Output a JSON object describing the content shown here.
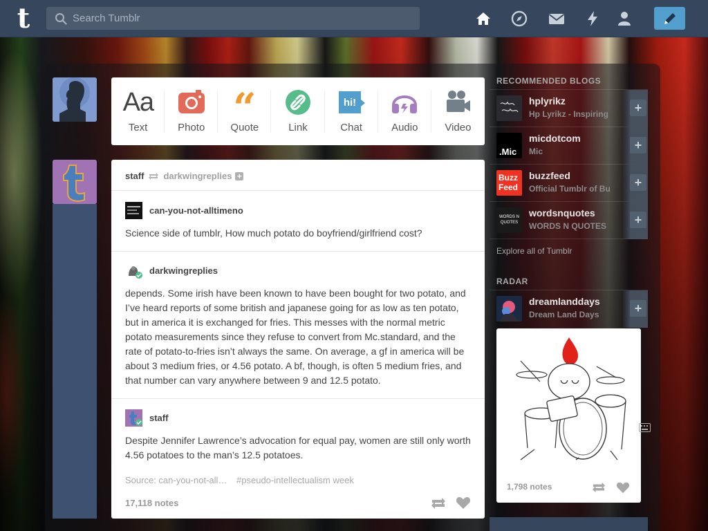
{
  "header": {
    "logo": "t",
    "search_placeholder": "Search Tumblr",
    "nav_icons": [
      "home-icon",
      "explore-icon",
      "inbox-icon",
      "activity-icon",
      "account-icon"
    ],
    "compose_icon": "pencil-icon"
  },
  "post_types": [
    {
      "label": "Text",
      "icon": "text-icon",
      "glyph": "Aa"
    },
    {
      "label": "Photo",
      "icon": "camera-icon"
    },
    {
      "label": "Quote",
      "icon": "quote-icon",
      "glyph": "“"
    },
    {
      "label": "Link",
      "icon": "link-icon"
    },
    {
      "label": "Chat",
      "icon": "chat-icon",
      "glyph": "hi!"
    },
    {
      "label": "Audio",
      "icon": "headphones-icon"
    },
    {
      "label": "Video",
      "icon": "video-camera-icon"
    }
  ],
  "post": {
    "author": "staff",
    "reblogged_from": "darkwingreplies",
    "trail": [
      {
        "name": "can-you-not-alltimeno",
        "text": "Science side of tumblr, How much potato do boyfriend/girlfriend cost?"
      },
      {
        "name": "darkwingreplies",
        "text": "depends. Some irish have been known to have been bought for two potato, and I’ve heard reports of some british and japanese going for as low as ten potato, but in america it is exchanged for fries. This messes with the normal metric potato measurements since they refuse to convert from Mc.standard, and the rate of potato-to-fries isn’t always the same. On average, a gf in america will be about 3 medium fries, or 4.56 potato. A bf, though, is often 5 medium fries, and that number can vary anywhere between 9 and 12.5 potato."
      },
      {
        "name": "staff",
        "text": "Despite Jennifer Lawrence’s advocation for equal pay, women are still only worth 4.56 potatoes to the man’s 12.5 potatoes."
      }
    ],
    "source": "Source: can-you-not-all…",
    "tag": "#pseudo-intellectualism week",
    "notes": "17,118 notes"
  },
  "sidebar": {
    "recommended_heading": "RECOMMENDED BLOGS",
    "blogs": [
      {
        "name": "hplyrikz",
        "title": "Hp Lyrikz - Inspiring",
        "follow": "+"
      },
      {
        "name": "micdotcom",
        "title": "Mic",
        "follow": "+",
        "avatar_text": ".Mic"
      },
      {
        "name": "buzzfeed",
        "title": "Official Tumblr of Bu",
        "follow": "+",
        "avatar_text": "Buzz Feed"
      },
      {
        "name": "wordsnquotes",
        "title": "WORDS N QUOTES",
        "follow": "+",
        "avatar_text": "WORDS N QUOTES"
      }
    ],
    "explore": "Explore all of Tumblr",
    "radar_heading": "RADAR",
    "radar": {
      "name": "dreamlanddays",
      "title": "Dream Land Days",
      "follow": "+",
      "notes": "1,798 notes"
    }
  },
  "colors": {
    "header_bg": "#36465d",
    "compose_bg": "#529ecc",
    "photo": "#e16a58",
    "quote": "#f2992e",
    "link": "#56bc8a",
    "chat": "#529ecc",
    "audio": "#a77dc2",
    "video": "#748089"
  }
}
